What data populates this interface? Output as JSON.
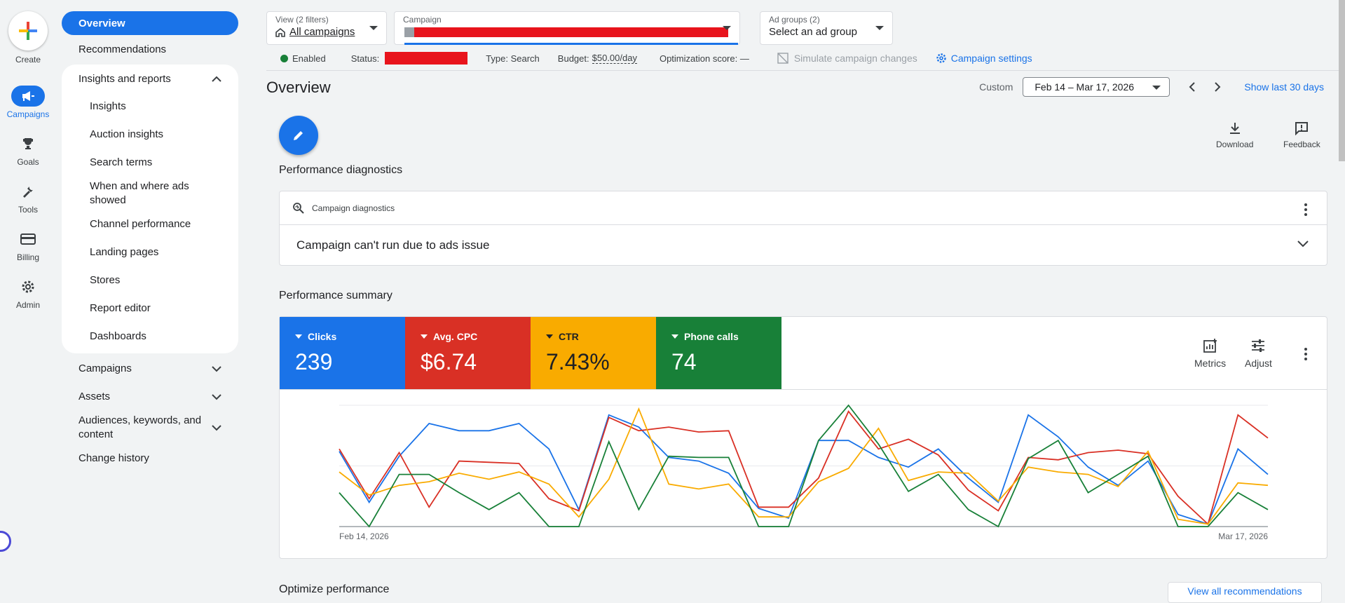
{
  "rail": {
    "create": "Create",
    "campaigns": "Campaigns",
    "goals": "Goals",
    "tools": "Tools",
    "billing": "Billing",
    "admin": "Admin"
  },
  "nav": {
    "overview": "Overview",
    "recommendations": "Recommendations",
    "insights_reports": "Insights and reports",
    "sub": [
      "Insights",
      "Auction insights",
      "Search terms",
      "When and where ads showed",
      "Channel performance",
      "Landing pages",
      "Stores",
      "Report editor",
      "Dashboards"
    ],
    "campaigns": "Campaigns",
    "assets": "Assets",
    "audiences": "Audiences, keywords, and content",
    "change_history": "Change history"
  },
  "topbar": {
    "view_label": "View (2 filters)",
    "view_value": "All campaigns",
    "campaign_label": "Campaign",
    "adgroups_label": "Ad groups (2)",
    "adgroups_value": "Select an ad group"
  },
  "status": {
    "enabled": "Enabled",
    "status_label": "Status:",
    "type": "Type: Search",
    "budget_label": "Budget:",
    "budget_value": "$50.00/day",
    "opt_score": "Optimization score: —",
    "simulate": "Simulate campaign changes",
    "settings": "Campaign settings"
  },
  "header": {
    "title": "Overview",
    "custom": "Custom",
    "date_range": "Feb 14 – Mar 17, 2026",
    "show_last": "Show last 30 days",
    "download": "Download",
    "feedback": "Feedback"
  },
  "diagnostics": {
    "section": "Performance diagnostics",
    "head": "Campaign diagnostics",
    "message": "Campaign can't run due to ads issue"
  },
  "summary": {
    "section": "Performance summary",
    "metrics_btn": "Metrics",
    "adjust_btn": "Adjust",
    "tiles": [
      {
        "name": "Clicks",
        "value": "239",
        "color": "#1a73e8"
      },
      {
        "name": "Avg. CPC",
        "value": "$6.74",
        "color": "#d93025"
      },
      {
        "name": "CTR",
        "value": "7.43%",
        "color": "#f9ab00"
      },
      {
        "name": "Phone calls",
        "value": "74",
        "color": "#188038"
      }
    ]
  },
  "optimize": {
    "title": "Optimize performance",
    "view_all": "View all recommendations"
  },
  "chart_data": {
    "type": "line",
    "x_start_label": "Feb 14, 2026",
    "x_end_label": "Mar 17, 2026",
    "ylim": [
      0,
      100
    ],
    "grid": true,
    "series": [
      {
        "name": "Clicks",
        "color": "#1a73e8",
        "values": [
          62,
          20,
          58,
          85,
          79,
          79,
          85,
          64,
          14,
          92,
          82,
          57,
          54,
          44,
          15,
          7,
          71,
          71,
          57,
          49,
          64,
          40,
          20,
          92,
          74,
          49,
          34,
          54,
          10,
          2,
          64,
          43
        ]
      },
      {
        "name": "Avg. CPC",
        "color": "#d93025",
        "values": [
          64,
          23,
          61,
          16,
          54,
          53,
          52,
          23,
          13,
          90,
          79,
          82,
          78,
          79,
          16,
          16,
          40,
          95,
          64,
          72,
          59,
          30,
          13,
          57,
          55,
          61,
          63,
          60,
          25,
          2,
          92,
          73
        ]
      },
      {
        "name": "CTR",
        "color": "#f9ab00",
        "values": [
          45,
          26,
          34,
          37,
          44,
          39,
          45,
          35,
          8,
          39,
          97,
          35,
          31,
          35,
          8,
          8,
          37,
          48,
          81,
          38,
          45,
          44,
          21,
          49,
          45,
          43,
          33,
          62,
          6,
          2,
          36,
          34
        ]
      },
      {
        "name": "Phone calls",
        "color": "#188038",
        "values": [
          28,
          0,
          43,
          43,
          28,
          14,
          28,
          0,
          0,
          70,
          14,
          58,
          57,
          57,
          0,
          0,
          71,
          100,
          68,
          29,
          43,
          14,
          0,
          56,
          71,
          28,
          43,
          58,
          0,
          0,
          28,
          14
        ]
      }
    ]
  }
}
